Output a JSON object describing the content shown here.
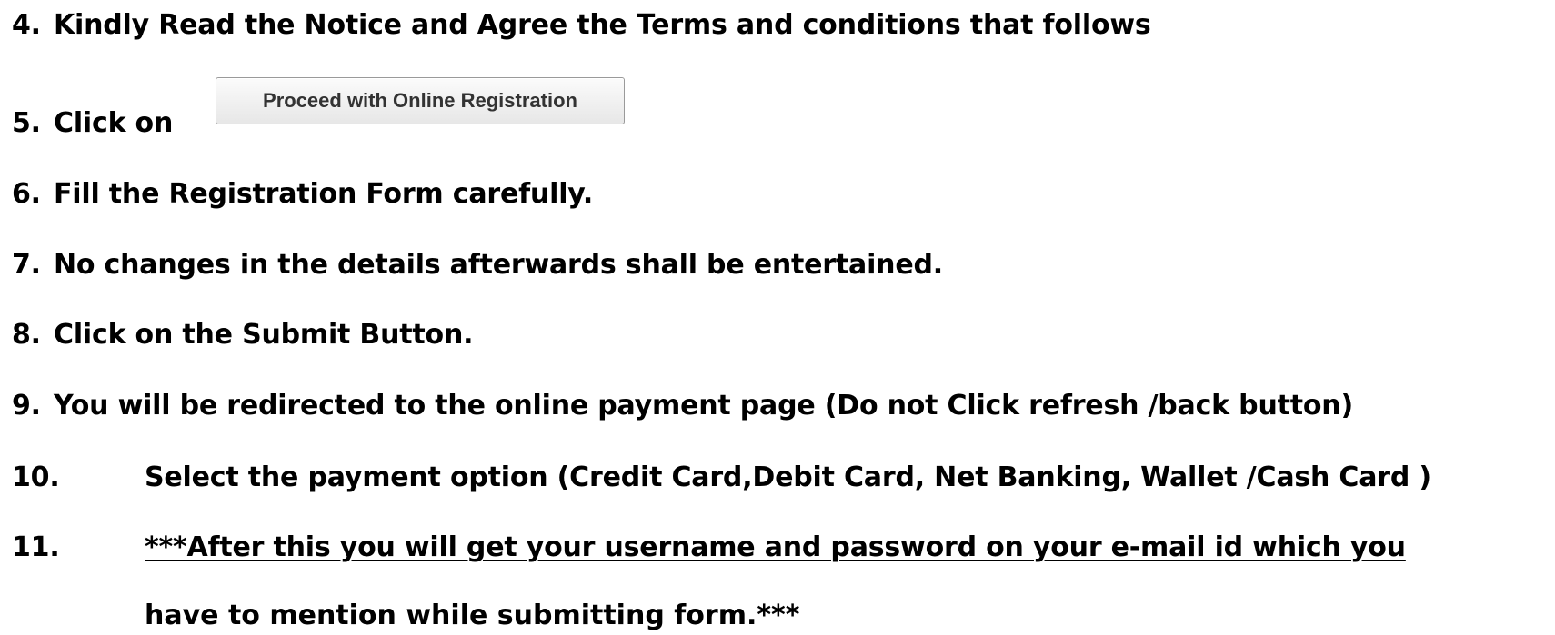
{
  "steps": [
    {
      "num": "4.",
      "text": "Kindly Read the Notice  and Agree the Terms and conditions that follows"
    },
    {
      "num": "5.",
      "text": "Click on"
    },
    {
      "num": "6.",
      "text": "Fill the Registration Form carefully."
    },
    {
      "num": "7.",
      "text": "No changes in the details afterwards shall be entertained."
    },
    {
      "num": "8.",
      "text": "Click on the Submit Button."
    },
    {
      "num": "9.",
      "text": "You will be redirected to the online payment page (Do not Click refresh /back button)"
    },
    {
      "num": "10.",
      "text": "Select the payment option (Credit Card,Debit Card, Net Banking, Wallet /Cash Card )"
    },
    {
      "num": "11.",
      "text": "***After this you will get your username and password on your e-mail id which you",
      "continuation": "have to mention while submitting form.***"
    }
  ],
  "proceed_button": {
    "label": "Proceed with Online Registration"
  }
}
